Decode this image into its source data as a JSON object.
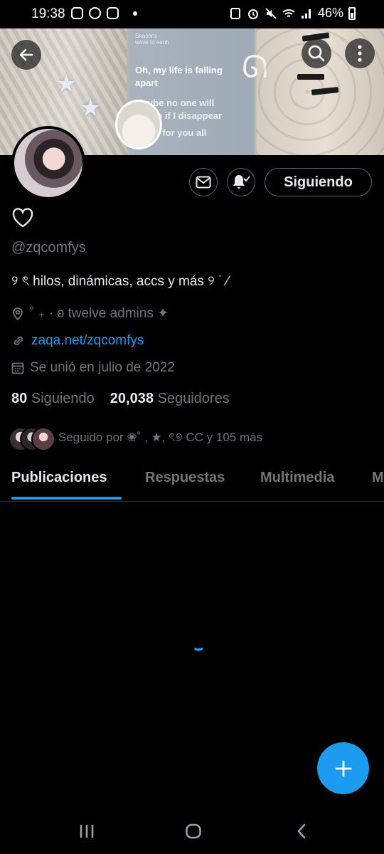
{
  "status_bar": {
    "time": "19:38",
    "battery": "46%"
  },
  "banner": {
    "song_title": "Seasons",
    "song_artist": "wave to earth",
    "lyric_1": "Oh, my life is falling apart",
    "lyric_2": "Maybe no one will notice if I disappear",
    "lyric_3": "I pray for you all"
  },
  "profile": {
    "follow_label": "Siguiendo",
    "heart_glyph": "♡",
    "handle": "@zqcomfys",
    "bio": "୨ ৎ hilos, dinámicas, accs y más ୨ ˙ ⁄",
    "location": "˚ ₊ · ʚ twelve admins ✦",
    "link": "zaqa.net/zqcomfys",
    "joined": "Se unió en julio de 2022",
    "following_count": "80",
    "following_label": "Siguiendo",
    "followers_count": "20,038",
    "followers_label": "Seguidores",
    "followed_by": "Seguido por ❀˚ , ★, ৎ୭ CC y 105 más"
  },
  "tabs": [
    {
      "label": "Publicaciones",
      "active": true
    },
    {
      "label": "Respuestas",
      "active": false
    },
    {
      "label": "Multimedia",
      "active": false
    },
    {
      "label": "M",
      "active": false
    }
  ],
  "colors": {
    "accent": "#1d9bf0",
    "background": "#000000",
    "muted": "#71767b",
    "border": "#536471"
  }
}
